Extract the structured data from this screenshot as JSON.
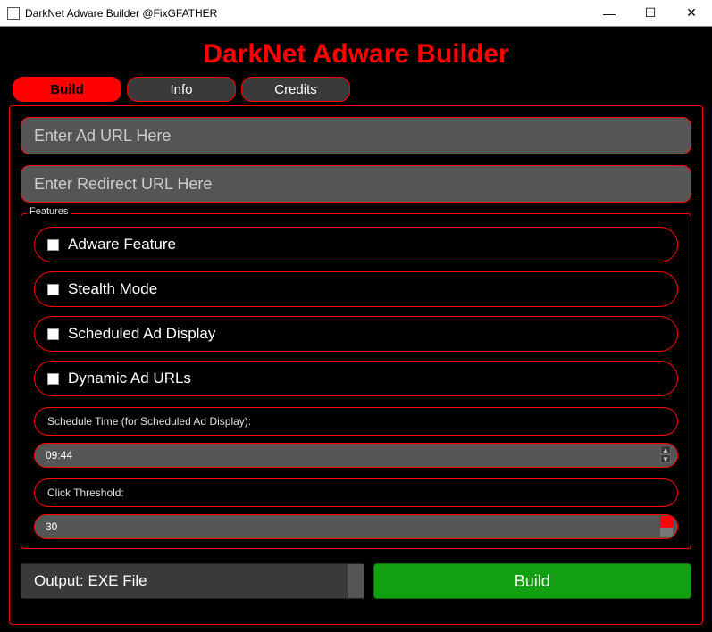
{
  "window": {
    "title": "DarkNet Adware Builder @FixGFATHER",
    "minimize": "—",
    "maximize": "☐",
    "close": "✕"
  },
  "app_title": "DarkNet Adware Builder",
  "tabs": [
    {
      "label": "Build",
      "active": true
    },
    {
      "label": "Info",
      "active": false
    },
    {
      "label": "Credits",
      "active": false
    }
  ],
  "inputs": {
    "ad_url_placeholder": "Enter Ad URL Here",
    "redirect_url_placeholder": "Enter Redirect URL Here"
  },
  "features": {
    "legend": "Features",
    "items": [
      {
        "label": "Adware Feature"
      },
      {
        "label": "Stealth Mode"
      },
      {
        "label": "Scheduled Ad Display"
      },
      {
        "label": "Dynamic Ad URLs"
      }
    ],
    "schedule_label": "Schedule Time (for Scheduled Ad Display):",
    "schedule_value": "09:44",
    "threshold_label": "Click Threshold:",
    "threshold_value": "30"
  },
  "output": {
    "label": "Output: EXE File"
  },
  "build_button": "Build"
}
